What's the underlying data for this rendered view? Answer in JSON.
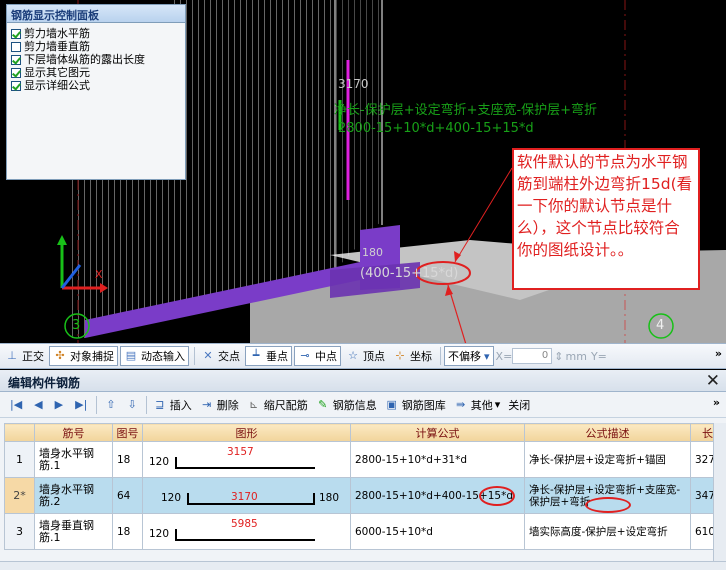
{
  "control_panel": {
    "title": "钢筋显示控制面板",
    "options": [
      {
        "label": "剪力墙水平筋",
        "checked": true
      },
      {
        "label": "剪力墙垂直筋",
        "checked": false
      },
      {
        "label": "下层墙体纵筋的露出长度",
        "checked": true
      },
      {
        "label": "显示其它图元",
        "checked": true
      },
      {
        "label": "显示详细公式",
        "checked": true
      }
    ]
  },
  "viewport": {
    "dim_3170": "3170",
    "formula_desc": "净长-保护层+设定弯折+支座宽-保护层+弯折",
    "formula_expr": "2800-15+10*d+400-15+15*d",
    "hook_value": "180",
    "hook_expr": "(400-15+15*d)",
    "axis_label_x": "X",
    "grid_no_left": "3",
    "grid_no_right": "4",
    "callout_text": "软件默认的节点为水平钢筋到端柱外边弯折15d(看一下你的默认节点是什么），这个节点比较符合你的图纸设计。。"
  },
  "snap_toolbar": {
    "items": [
      "正交",
      "对象捕捉",
      "动态输入",
      "交点",
      "垂点",
      "中点",
      "顶点",
      "坐标"
    ],
    "offset_mode": "不偏移",
    "x_label": "X=",
    "x_value": "0",
    "unit": "mm",
    "y_label": "Y="
  },
  "edit_panel": {
    "title": "编辑构件钢筋",
    "toolbar": [
      "插入",
      "删除",
      "缩尺配筋",
      "钢筋信息",
      "钢筋图库",
      "其他",
      "关闭"
    ],
    "columns": [
      "筋号",
      "图号",
      "图形",
      "计算公式",
      "公式描述",
      "长"
    ],
    "rows": [
      {
        "no": "1",
        "name": "墙身水平钢筋.1",
        "fig": "18",
        "hook_l": "120",
        "len": "3157",
        "hook_r": "",
        "formula": "2800-15+10*d+31*d",
        "desc": "净长-保护层+设定弯折+锚固",
        "length": "327"
      },
      {
        "no": "2*",
        "name": "墙身水平钢筋.2",
        "fig": "64",
        "hook_l": "120",
        "len": "3170",
        "hook_r": "180",
        "formula": "2800-15+10*d+400-15+15*d",
        "desc": "净长-保护层+设定弯折+支座宽-保护层+弯折",
        "length": "347"
      },
      {
        "no": "3",
        "name": "墙身垂直钢筋.1",
        "fig": "18",
        "hook_l": "120",
        "len": "5985",
        "hook_r": "",
        "formula": "6000-15+10*d",
        "desc": "墙实际高度-保护层+设定弯折",
        "length": "610"
      }
    ]
  },
  "colors": {
    "callout_red": "#e02020",
    "hook_green": "#18c018",
    "slab_purple": "#7a3cc8",
    "selected_row": "#b9dcee"
  }
}
